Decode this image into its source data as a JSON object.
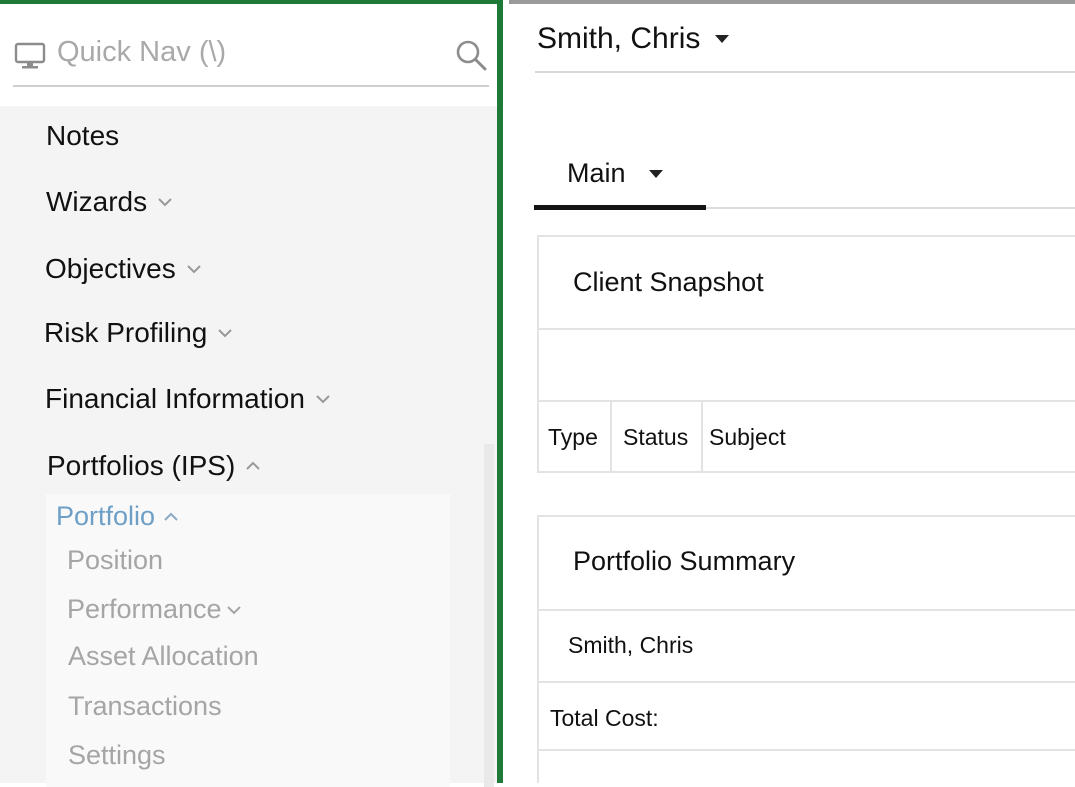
{
  "sidebar": {
    "quicknav": {
      "placeholder": "Quick Nav (\\)",
      "monitor_icon": "monitor-icon",
      "search_icon": "search-icon"
    },
    "items": [
      {
        "label": "Notes",
        "expandable": false
      },
      {
        "label": "Wizards",
        "expandable": true,
        "expanded": false
      },
      {
        "label": "Objectives",
        "expandable": true,
        "expanded": false
      },
      {
        "label": "Risk Profiling",
        "expandable": true,
        "expanded": false
      },
      {
        "label": "Financial Information",
        "expandable": true,
        "expanded": false
      },
      {
        "label": "Portfolios (IPS)",
        "expandable": true,
        "expanded": true
      }
    ],
    "submenu": {
      "label": "Portfolio",
      "expanded": true,
      "items": [
        {
          "label": "Position"
        },
        {
          "label": "Performance",
          "expandable": true
        },
        {
          "label": "Asset Allocation"
        },
        {
          "label": "Transactions"
        },
        {
          "label": "Settings"
        }
      ]
    }
  },
  "main": {
    "client_name": "Smith, Chris",
    "tab": {
      "label": "Main"
    },
    "client_snapshot": {
      "title": "Client Snapshot",
      "columns": [
        "Type",
        "Status",
        "Subject"
      ]
    },
    "portfolio_summary": {
      "title": "Portfolio Summary",
      "name": "Smith, Chris",
      "total_cost_label": "Total Cost:"
    }
  },
  "colors": {
    "accent_border": "#1f7a3a",
    "submenu_active": "#6e9fc7",
    "submenu_inactive": "#a5a5a5"
  }
}
